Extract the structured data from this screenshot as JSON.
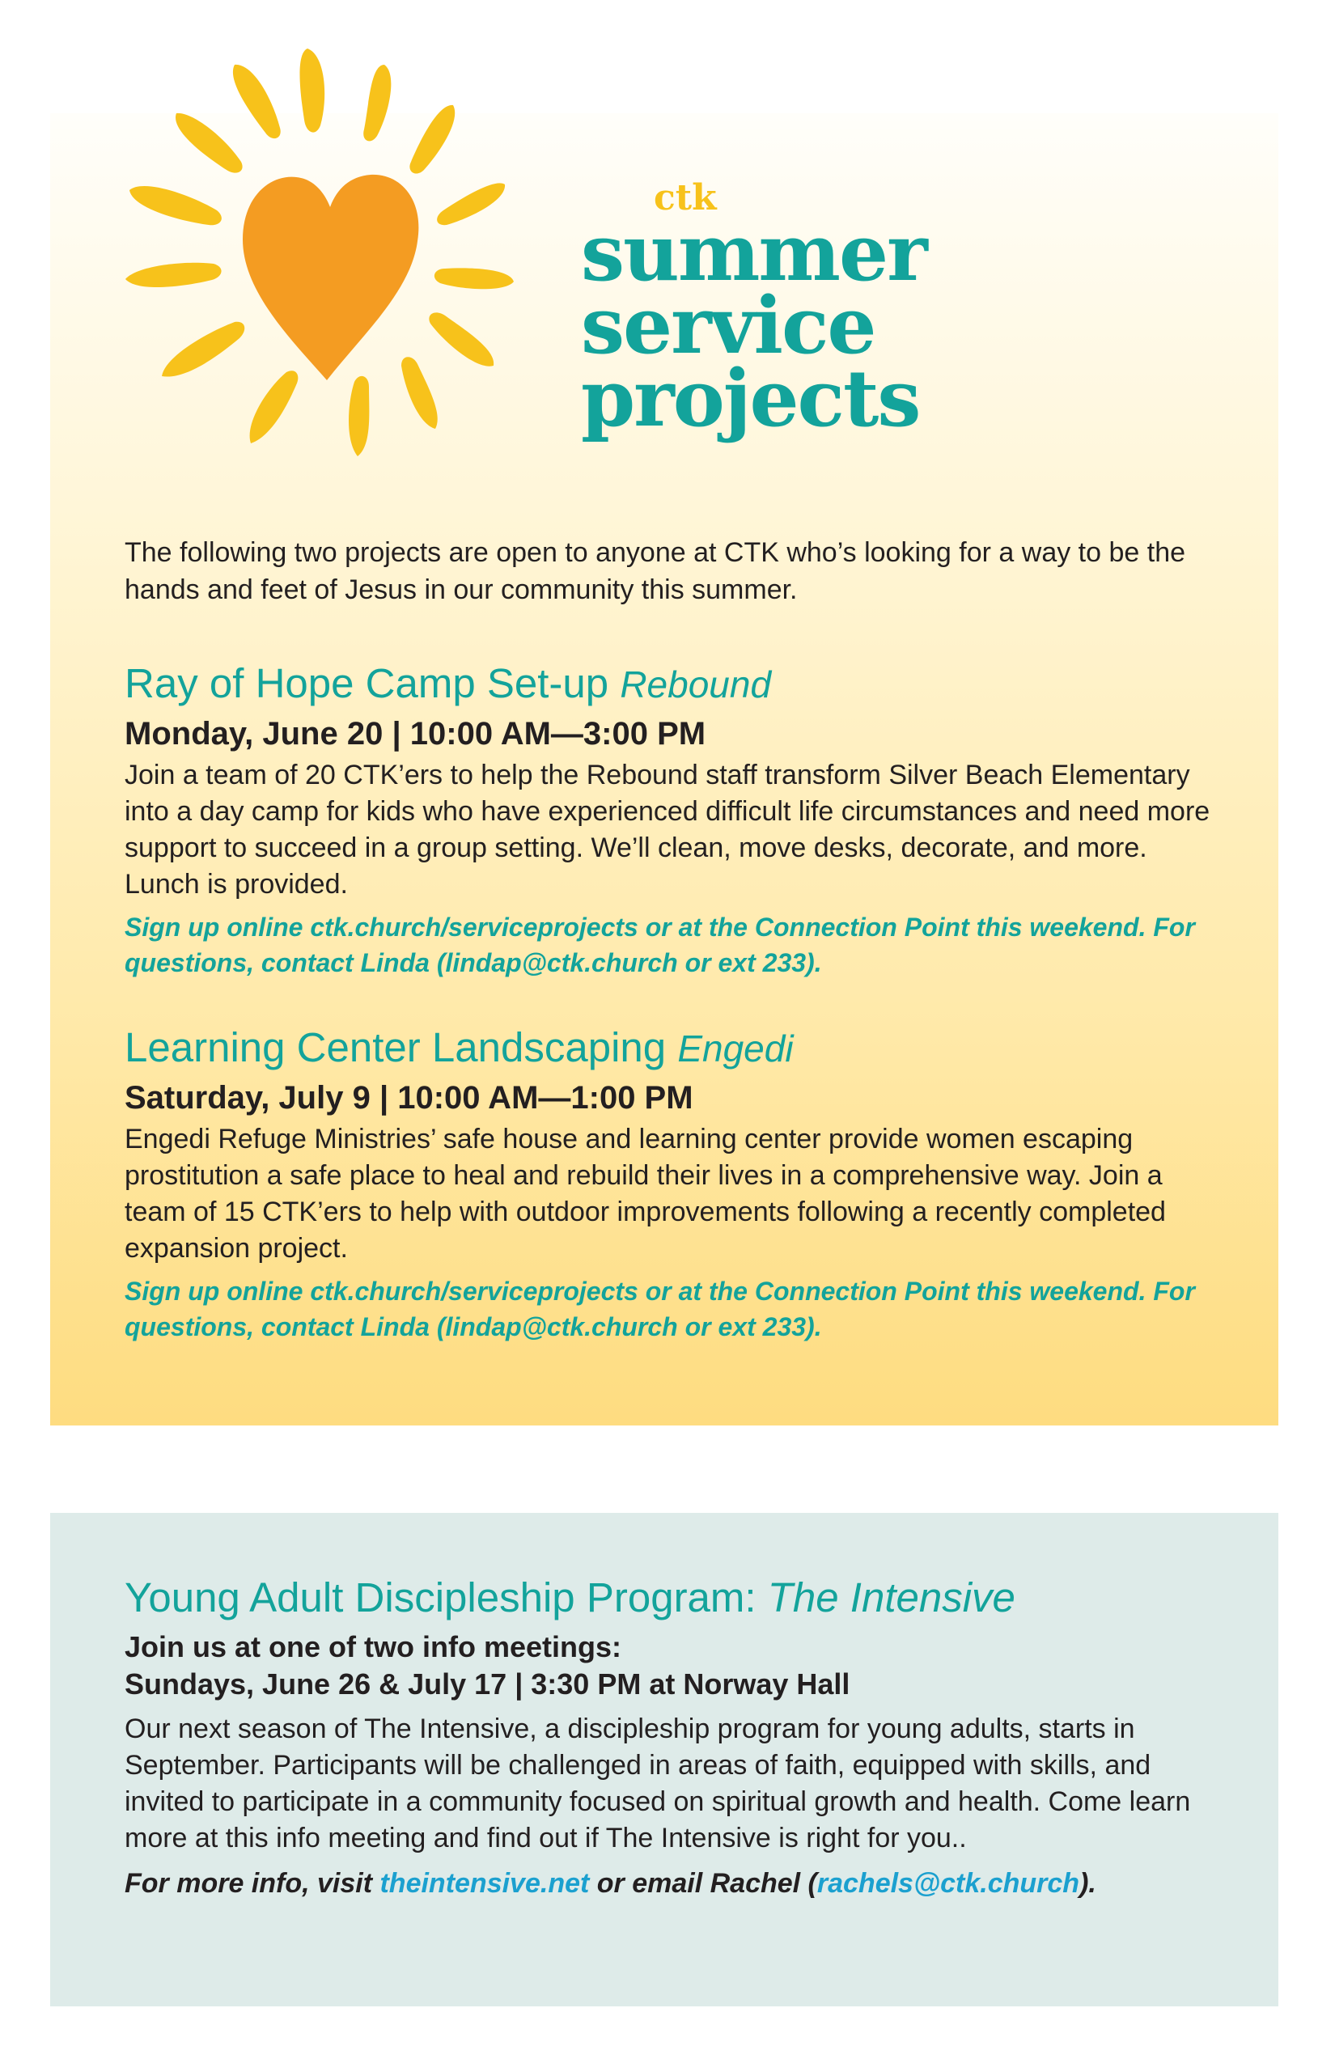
{
  "colors": {
    "teal": "#13a39b",
    "sun_yellow": "#f7c21b",
    "heart_orange": "#f49c22",
    "link_blue": "#1ba0cf",
    "panel_bottom": "#deebe9"
  },
  "logo": {
    "icon": "sun-heart-icon",
    "brand": "ctk",
    "title_lines": [
      "summer",
      "service",
      "projects"
    ]
  },
  "intro": "The following two projects are open to anyone at CTK who’s looking for a way to be the hands and feet of Jesus in our community this summer.",
  "projects": [
    {
      "title": "Ray of Hope Camp Set-up",
      "org": "Rebound",
      "date": "Monday, June 20 | 10:00 AM—3:00 PM",
      "description": "Join a team of 20 CTK’ers to help the Rebound staff transform Silver Beach Elementary into a day camp for kids who have experienced difficult life circumstances and need more support to succeed in a group setting. We’ll clean, move desks, decorate, and more. Lunch is provided.",
      "signup": "Sign up online ctk.church/serviceprojects or at the Connection Point this weekend. For questions, contact Linda (lindap@ctk.church or ext 233)."
    },
    {
      "title": "Learning Center Landscaping",
      "org": "Engedi",
      "date": "Saturday, July 9 | 10:00 AM—1:00 PM",
      "description": "Engedi Refuge Ministries’ safe house and learning center provide women escaping prostitution a safe place to heal and rebuild their lives in a comprehensive way. Join a team of 15 CTK’ers to help with outdoor improvements following a recently completed expansion project.",
      "signup": "Sign up online ctk.church/serviceprojects or at the Connection Point this weekend. For questions, contact Linda (lindap@ctk.church or ext 233)."
    }
  ],
  "young_adult": {
    "title": "Young Adult Discipleship Program:",
    "subtitle": "The Intensive",
    "meeting_line1": "Join us at one of two info meetings:",
    "meeting_line2": "Sundays, June 26 & July 17 | 3:30 PM at Norway Hall",
    "description": "Our next season of The Intensive, a discipleship program for young adults, starts in September. Participants will be challenged in areas of faith, equipped with skills, and invited to participate in a community focused on spiritual growth and health. Come learn more at this info meeting and find out if The Intensive is right for you..",
    "more_prefix": "For more info, visit ",
    "website": "theintensive.net",
    "more_middle": " or email Rachel (",
    "email": "rachels@ctk.church",
    "more_suffix": ")."
  }
}
